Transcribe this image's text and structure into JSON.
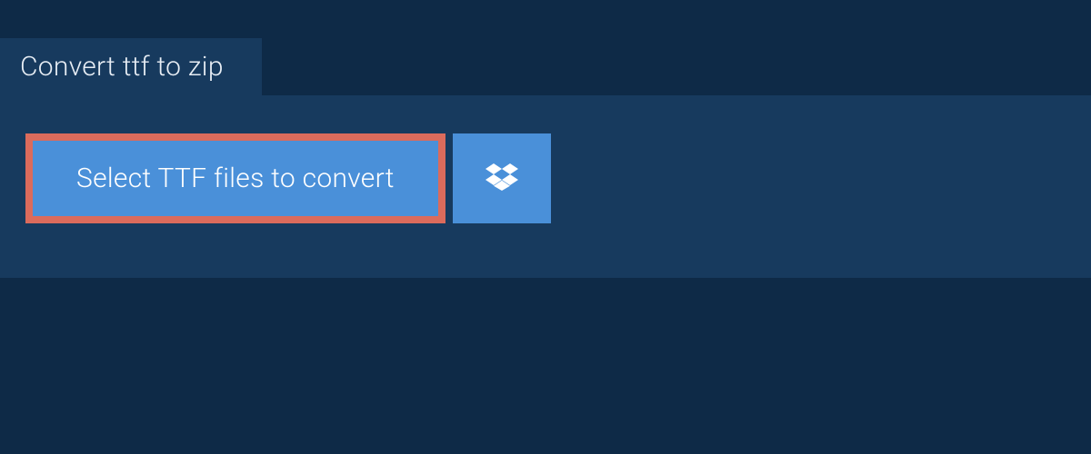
{
  "tab": {
    "title": "Convert ttf to zip"
  },
  "actions": {
    "select_label": "Select TTF files to convert"
  }
}
